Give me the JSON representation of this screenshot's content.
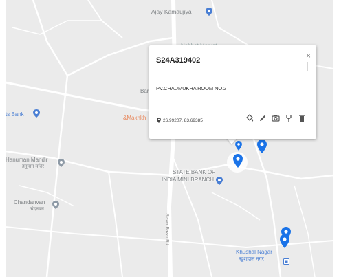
{
  "map": {
    "labels": {
      "ajay_kamaujiya": "Ajay Kamaujiya",
      "partial_top": "Nabhat Market",
      "ban_partial": "Ban",
      "makhkh_partial": "&Makhkh",
      "bank_left": "ts Bank",
      "hanuman_mandir": "Hanuman Mandir",
      "hanuman_mandir_hindi": "हनुमान मंदिर",
      "chandanvan": "Chandanvan",
      "chandanvan_hindi": "चंदनवन",
      "sbi_line1": "STATE BANK OF",
      "sbi_line2": "INDIA MINI BRANCH",
      "road_name": "Siswa Bazar Rd",
      "khushal_nagar": "Khushal Nagar",
      "khushal_nagar_hindi": "खुशहाल नगर"
    },
    "colors": {
      "land": "#ebebeb",
      "road": "#ffffff",
      "pin": "#1a73e8",
      "poi_gray": "#8e9aa6",
      "poi_blue": "#4a7fd4",
      "poi_orange": "#e8875b"
    }
  },
  "popup": {
    "title": "S24A319402",
    "close_label": "×",
    "address": "PV.CHAUMUKHA ROOM NO.2",
    "coordinates": "26.99207, 83.69385",
    "actions": [
      "fill-icon",
      "pencil-icon",
      "camera-icon",
      "fork-icon",
      "trash-icon"
    ]
  }
}
